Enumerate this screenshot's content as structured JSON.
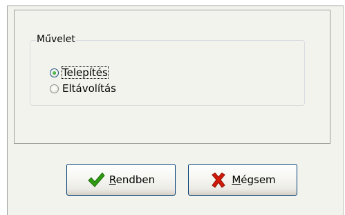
{
  "group": {
    "title": "Művelet"
  },
  "options": [
    {
      "label": "Telepítés",
      "checked": true
    },
    {
      "label": "Eltávolítás",
      "checked": false
    }
  ],
  "buttons": {
    "ok": {
      "mnemonic": "R",
      "rest": "endben",
      "icon": "checkmark-icon"
    },
    "cancel": {
      "mnemonic": "M",
      "rest": "égsem",
      "icon": "red-x-icon"
    }
  },
  "colors": {
    "panel_bg": "#f3f3ee",
    "radio_dot": "#21a121",
    "check_green": "#2f9b12",
    "cancel_red": "#d21a0c"
  }
}
